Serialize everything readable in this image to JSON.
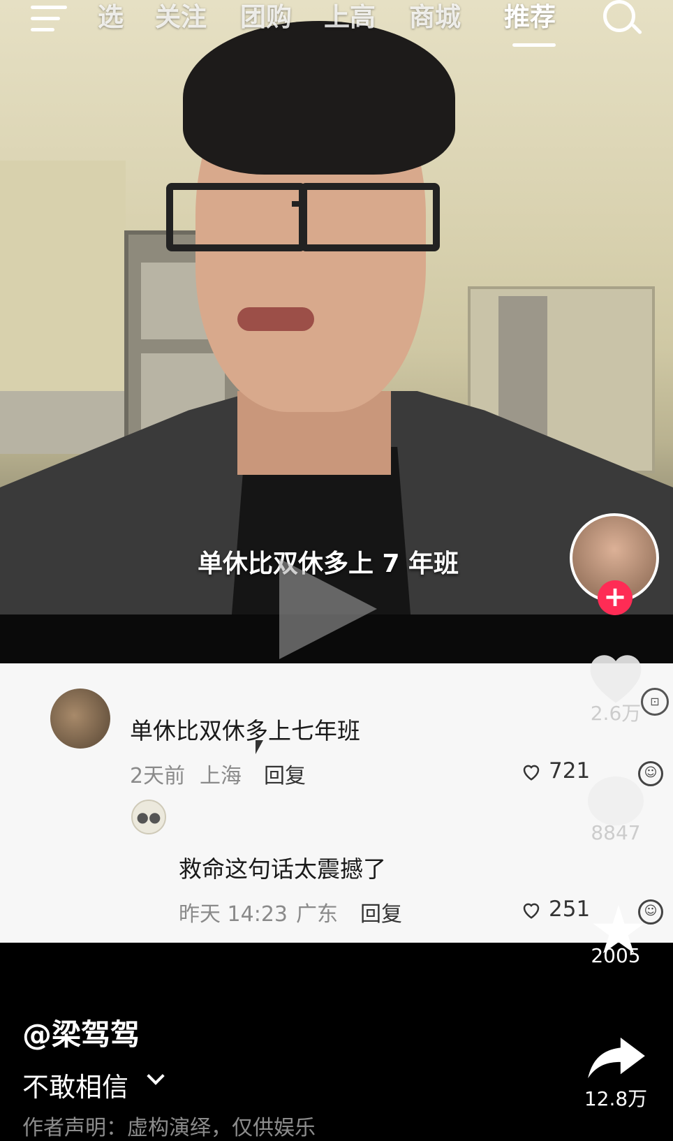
{
  "nav": {
    "tabs": [
      "选",
      "关注",
      "团购",
      "上高",
      "商城",
      "推荐"
    ],
    "active_tab": "推荐"
  },
  "video": {
    "caption": "单休比双休多上 7 年班"
  },
  "comments": [
    {
      "text": "单休比双休多上七年班",
      "time": "2天前",
      "location": "上海",
      "reply_label": "回复",
      "likes": "721"
    },
    {
      "text": "救命这句话太震撼了",
      "time": "昨天 14:23",
      "location": "广东",
      "reply_label": "回复",
      "likes": "251"
    }
  ],
  "rail": {
    "likes": "2.6万",
    "comments": "8847",
    "favorites": "2005",
    "shares": "12.8万",
    "accent_color": "#fe2c55"
  },
  "post": {
    "author": "@梁驾驾",
    "description": "不敢相信",
    "disclaimer": "作者声明：虚构演绎，仅供娱乐"
  }
}
